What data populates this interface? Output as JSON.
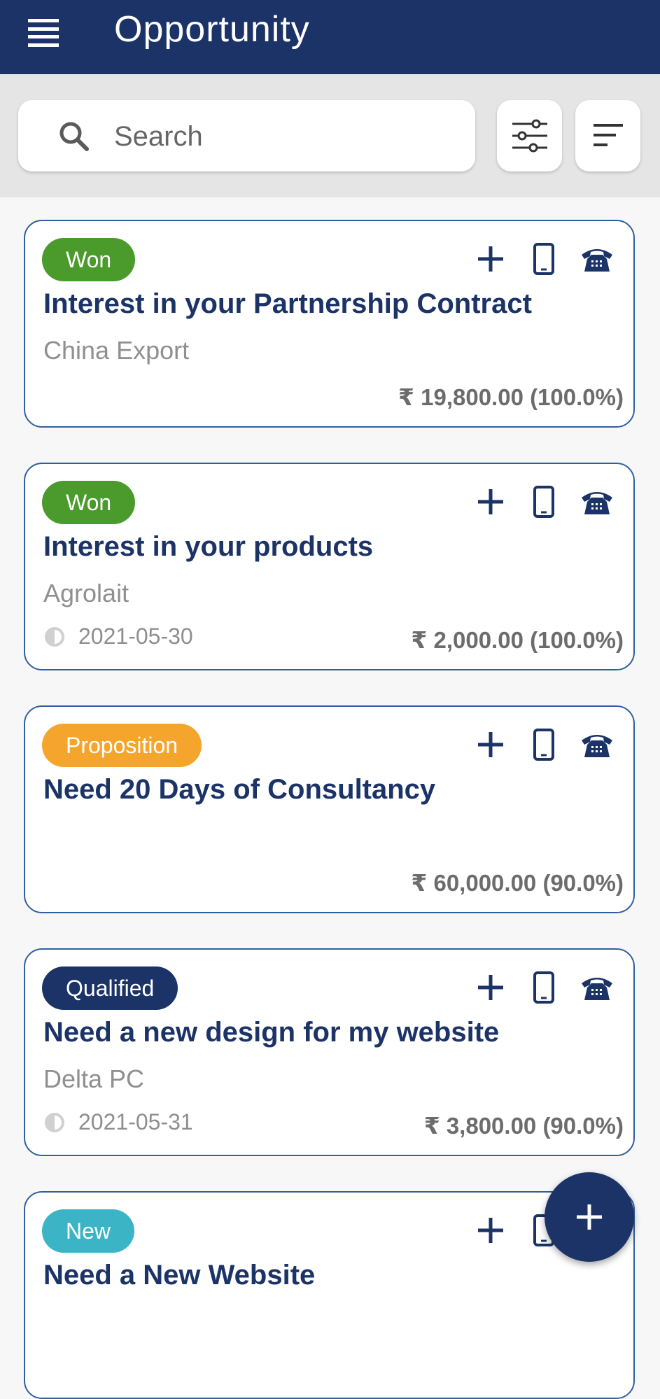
{
  "appbar": {
    "title": "Opportunity"
  },
  "search": {
    "placeholder": "Search"
  },
  "icons": {
    "menu": "hamburger-menu-icon",
    "search": "search-icon",
    "filter": "sliders-filter-icon",
    "sort": "sort-lines-icon",
    "add": "plus-icon",
    "mobile": "mobile-phone-icon",
    "phone": "telephone-icon",
    "date": "clock-icon",
    "fab": "plus-icon"
  },
  "colors": {
    "primary": "#1b3366",
    "won": "#4a9a2c",
    "proposition": "#f5a52c",
    "qualified": "#1b3366",
    "new": "#3bb5c6"
  },
  "opportunities": [
    {
      "stage": "Won",
      "stage_color": "#4a9a2c",
      "title": "Interest in your Partnership Contract",
      "partner": "China Export",
      "date": "",
      "amount": "₹ 19,800.00 (100.0%)"
    },
    {
      "stage": "Won",
      "stage_color": "#4a9a2c",
      "title": "Interest in your products",
      "partner": "Agrolait",
      "date": "2021-05-30",
      "amount": "₹ 2,000.00 (100.0%)"
    },
    {
      "stage": "Proposition",
      "stage_color": "#f5a52c",
      "title": "Need 20 Days of Consultancy",
      "partner": "",
      "date": "",
      "amount": "₹ 60,000.00 (90.0%)"
    },
    {
      "stage": "Qualified",
      "stage_color": "#1b3366",
      "title": "Need a new design for my website",
      "partner": "Delta PC",
      "date": "2021-05-31",
      "amount": "₹ 3,800.00 (90.0%)"
    },
    {
      "stage": "New",
      "stage_color": "#3bb5c6",
      "title": "Need a New Website",
      "partner": "",
      "date": "",
      "amount": ""
    }
  ]
}
